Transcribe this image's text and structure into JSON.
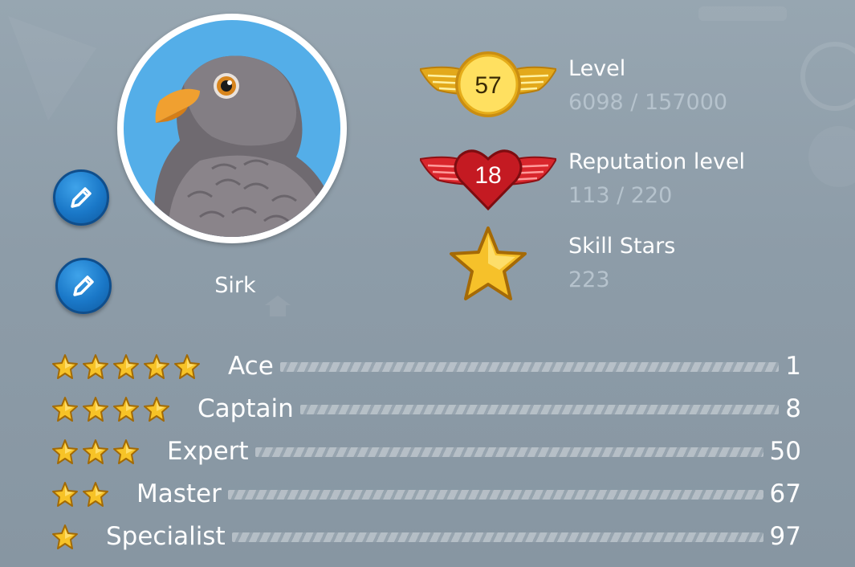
{
  "colors": {
    "background": "#8f9eaa",
    "edit_button": "#1a78c8",
    "avatar_bg": "#54aee8",
    "level_badge": "#f2c21c",
    "reputation_badge": "#d9262c",
    "value_text": "#b6c3cd"
  },
  "profile": {
    "name": "Sirk",
    "avatar_icon": "pigeon-avatar",
    "edit_icon": "pencil-icon"
  },
  "stats": {
    "level": {
      "badge": "57",
      "title": "Level",
      "value": "6098 / 157000",
      "icon": "gold-winged-badge-icon",
      "progress": 0.0388
    },
    "reputation": {
      "badge": "18",
      "title": "Reputation level",
      "value": "113 / 220",
      "icon": "red-winged-heart-icon",
      "progress": 0.5136
    },
    "skill_stars": {
      "title": "Skill Stars",
      "value": "223",
      "icon": "gold-star-icon"
    }
  },
  "ranks": [
    {
      "stars": 5,
      "name": "Ace",
      "count": "1"
    },
    {
      "stars": 4,
      "name": "Captain",
      "count": "8"
    },
    {
      "stars": 3,
      "name": "Expert",
      "count": "50"
    },
    {
      "stars": 2,
      "name": "Master",
      "count": "67"
    },
    {
      "stars": 1,
      "name": "Specialist",
      "count": "97"
    }
  ]
}
